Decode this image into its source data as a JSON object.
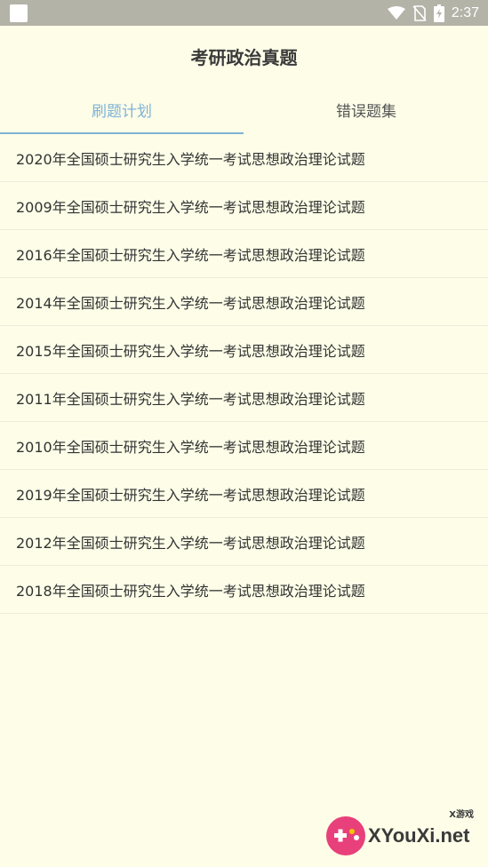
{
  "status_bar": {
    "time": "2:37",
    "icons": [
      "app-icon",
      "wifi-icon",
      "no-sim-icon",
      "battery-icon"
    ]
  },
  "header": {
    "title": "考研政治真题"
  },
  "tabs": [
    {
      "label": "刷题计划",
      "active": true
    },
    {
      "label": "错误题集",
      "active": false
    }
  ],
  "list": [
    "2020年全国硕士研究生入学统一考试思想政治理论试题",
    "2009年全国硕士研究生入学统一考试思想政治理论试题",
    "2016年全国硕士研究生入学统一考试思想政治理论试题",
    "2014年全国硕士研究生入学统一考试思想政治理论试题",
    "2015年全国硕士研究生入学统一考试思想政治理论试题",
    "2011年全国硕士研究生入学统一考试思想政治理论试题",
    "2010年全国硕士研究生入学统一考试思想政治理论试题",
    "2019年全国硕士研究生入学统一考试思想政治理论试题",
    "2012年全国硕士研究生入学统一考试思想政治理论试题",
    "2018年全国硕士研究生入学统一考试思想政治理论试题"
  ],
  "watermark": {
    "text": "XYouXi.net",
    "small": "X游戏"
  },
  "colors": {
    "background": "#fdfde8",
    "status_bar": "#b3b3a8",
    "accent": "#7fb3d5"
  }
}
